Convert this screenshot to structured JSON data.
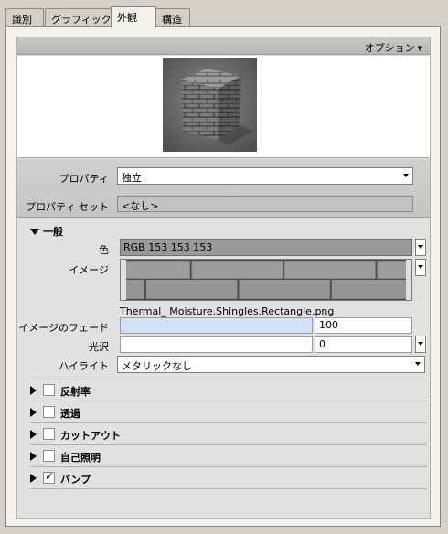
{
  "tabs": [
    {
      "label": "識別"
    },
    {
      "label": "グラフィックス"
    },
    {
      "label": "外観"
    },
    {
      "label": "構造"
    }
  ],
  "options": {
    "label": "オプション"
  },
  "properties": {
    "property_label": "プロパティ",
    "property_value": "独立",
    "property_set_label": "プロパティ セット",
    "property_set_value": "<なし>"
  },
  "general": {
    "title": "一般",
    "color_label": "色",
    "color_value": "RGB 153 153 153",
    "color_swatch": "#999999",
    "image_label": "イメージ",
    "image_filename": "Thermal_ Moisture.Shingles.Rectangle.png",
    "fade_label": "イメージのフェード",
    "fade_value": "100",
    "gloss_label": "光沢",
    "gloss_value": "0",
    "highlight_label": "ハイライト",
    "highlight_value": "メタリックなし"
  },
  "sections": [
    {
      "label": "反射率",
      "checked": false
    },
    {
      "label": "透過",
      "checked": false
    },
    {
      "label": "カットアウト",
      "checked": false
    },
    {
      "label": "自己照明",
      "checked": false
    },
    {
      "label": "バンプ",
      "checked": true
    }
  ],
  "icons": {
    "expand_open": "triangle-down-icon",
    "expand_closed": "triangle-right-icon",
    "dropdown": "chevron-down-icon",
    "check": "check-icon"
  }
}
